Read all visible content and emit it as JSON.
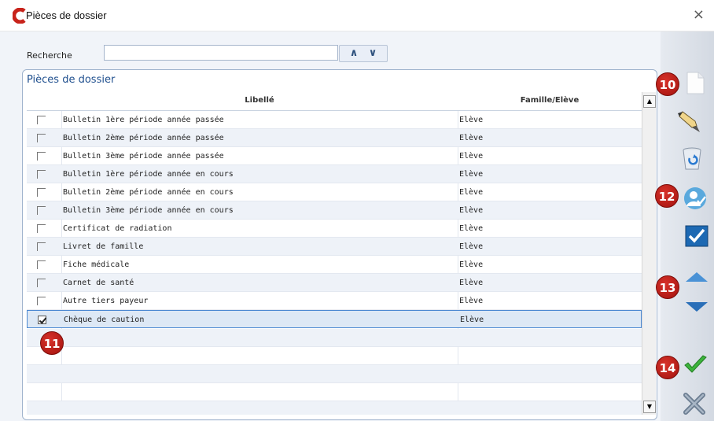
{
  "window": {
    "title": "Pièces de dossier",
    "close_icon": "close-icon"
  },
  "search": {
    "label": "Recherche",
    "value": "",
    "nav_up": "∧",
    "nav_down": "∨"
  },
  "group": {
    "title": "Pièces de dossier"
  },
  "table": {
    "columns": [
      "Libellé",
      "Famille/Elève"
    ],
    "rows": [
      {
        "libelle": "Bulletin 1ère période année passée",
        "famille": "Elève",
        "checked": false
      },
      {
        "libelle": "Bulletin 2ème période année passée",
        "famille": "Elève",
        "checked": false
      },
      {
        "libelle": "Bulletin 3ème période année passée",
        "famille": "Elève",
        "checked": false
      },
      {
        "libelle": "Bulletin 1ère période année en cours",
        "famille": "Elève",
        "checked": false
      },
      {
        "libelle": "Bulletin 2ème période année en cours",
        "famille": "Elève",
        "checked": false
      },
      {
        "libelle": "Bulletin 3ème période année en cours",
        "famille": "Elève",
        "checked": false
      },
      {
        "libelle": "Certificat de radiation",
        "famille": "Elève",
        "checked": false
      },
      {
        "libelle": "Livret de famille",
        "famille": "Elève",
        "checked": false
      },
      {
        "libelle": "Fiche médicale",
        "famille": "Elève",
        "checked": false
      },
      {
        "libelle": "Carnet de santé",
        "famille": "Elève",
        "checked": false
      },
      {
        "libelle": "Autre tiers payeur",
        "famille": "Elève",
        "checked": false
      },
      {
        "libelle": "Chèque de caution",
        "famille": "Elève",
        "checked": true
      }
    ]
  },
  "toolbar": {
    "icons": [
      "new-document-icon",
      "edit-pen-icon",
      "recycle-bin-icon",
      "user-check-icon",
      "checkmark-box-icon",
      "arrow-up-icon",
      "arrow-down-icon",
      "validate-icon",
      "cancel-icon"
    ]
  },
  "callouts": {
    "c10": "10",
    "c11": "11",
    "c12": "12",
    "c13": "13",
    "c14": "14"
  },
  "colors": {
    "accent": "#1f4f8e",
    "badge": "#c4201a",
    "selection_border": "#4b88d1"
  }
}
